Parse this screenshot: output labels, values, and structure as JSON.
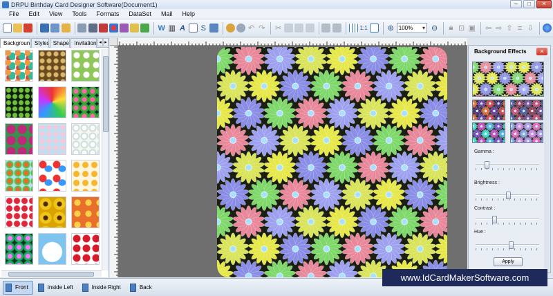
{
  "window": {
    "title": "DRPU Birthday Card Designer Software(Document1)",
    "min": "–",
    "max": "□",
    "close": "✕"
  },
  "menu": [
    "File",
    "Edit",
    "View",
    "Tools",
    "Formats",
    "DataSet",
    "Mail",
    "Help"
  ],
  "toolbar": {
    "zoom_value": "100%"
  },
  "left_panel": {
    "tabs": [
      "Backgrounds",
      "Styles",
      "Shapes",
      "Invitation Te"
    ],
    "tab_arrows": [
      "◂",
      "▸"
    ]
  },
  "right_panel": {
    "title": "Background Effects",
    "close": "✕",
    "sliders": [
      {
        "label": "Gamma :",
        "value": 0.15
      },
      {
        "label": "Brightness :",
        "value": 0.52
      },
      {
        "label": "Contrast :",
        "value": 0.28
      },
      {
        "label": "Hue :",
        "value": 0.56
      }
    ],
    "apply_label": "Apply"
  },
  "pages": [
    {
      "label": "Front",
      "active": true
    },
    {
      "label": "Inside Left",
      "active": false
    },
    {
      "label": "Inside Right",
      "active": false
    },
    {
      "label": "Back",
      "active": false
    }
  ],
  "watermark": "www.IdCardMakerSoftware.com",
  "colors": {
    "accent": "#3a78c4",
    "watermark_bg": "#1d2a5a",
    "canvas_bg": "#6f6f6f"
  }
}
